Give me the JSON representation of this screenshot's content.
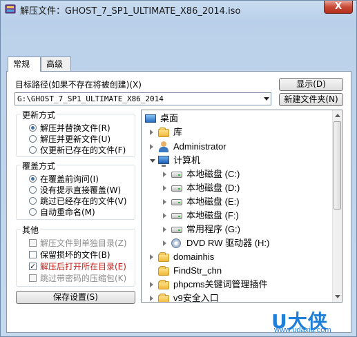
{
  "window": {
    "title": "解压文件：GHOST_7_SP1_ULTIMATE_X86_2014.iso",
    "close_label": "X"
  },
  "tabs": [
    {
      "label": "常规",
      "active": true
    },
    {
      "label": "高级",
      "active": false
    }
  ],
  "target_path": {
    "label": "目标路径(如果不存在将被创建)(X)",
    "value": "G:\\GHOST_7_SP1_ULTIMATE_X86_2014"
  },
  "buttons": {
    "show": "显示(D)",
    "new_folder": "新建文件夹(N)",
    "save_settings": "保存设置(S)"
  },
  "update_mode": {
    "title": "更新方式",
    "options": [
      {
        "label": "解压并替换文件(R)",
        "selected": true
      },
      {
        "label": "解压并更新文件(U)",
        "selected": false
      },
      {
        "label": "仅更新已存在的文件(F)",
        "selected": false
      }
    ]
  },
  "overwrite_mode": {
    "title": "覆盖方式",
    "options": [
      {
        "label": "在覆盖前询问(I)",
        "selected": true
      },
      {
        "label": "没有提示直接覆盖(W)",
        "selected": false
      },
      {
        "label": "跳过已经存在的文件(V)",
        "selected": false
      },
      {
        "label": "自动重命名(M)",
        "selected": false
      }
    ]
  },
  "misc": {
    "title": "其他",
    "options": [
      {
        "label": "解压文件到单独目录(Z)",
        "checked": false,
        "enabled": false
      },
      {
        "label": "保留损坏的文件(B)",
        "checked": false,
        "enabled": true
      },
      {
        "label": "解压后打开所在目录(E)",
        "checked": true,
        "enabled": true
      },
      {
        "label": "跳过带密码的压缩包(K)",
        "checked": false,
        "enabled": false
      }
    ]
  },
  "tree": {
    "nodes": [
      {
        "label": "桌面",
        "icon": "desktop-icon"
      },
      {
        "label": "库",
        "icon": "library-icon"
      },
      {
        "label": "Administrator",
        "icon": "user-icon"
      },
      {
        "label": "计算机",
        "icon": "computer-icon"
      },
      {
        "label": "本地磁盘 (C:)",
        "icon": "drive-icon"
      },
      {
        "label": "本地磁盘 (D:)",
        "icon": "drive-icon"
      },
      {
        "label": "本地磁盘 (E:)",
        "icon": "drive-icon"
      },
      {
        "label": "本地磁盘 (F:)",
        "icon": "drive-icon"
      },
      {
        "label": "常用程序 (G:)",
        "icon": "drive-icon"
      },
      {
        "label": "DVD RW 驱动器 (H:)",
        "icon": "dvd-icon"
      },
      {
        "label": "domainhis",
        "icon": "folder-icon"
      },
      {
        "label": "FindStr_chn",
        "icon": "folder-icon"
      },
      {
        "label": "phpcms关键词管理插件",
        "icon": "folder-icon"
      },
      {
        "label": "v9安全入口",
        "icon": "folder-icon"
      }
    ]
  },
  "watermark": {
    "brand": "U大侠",
    "url": "www.udaxia.com"
  }
}
